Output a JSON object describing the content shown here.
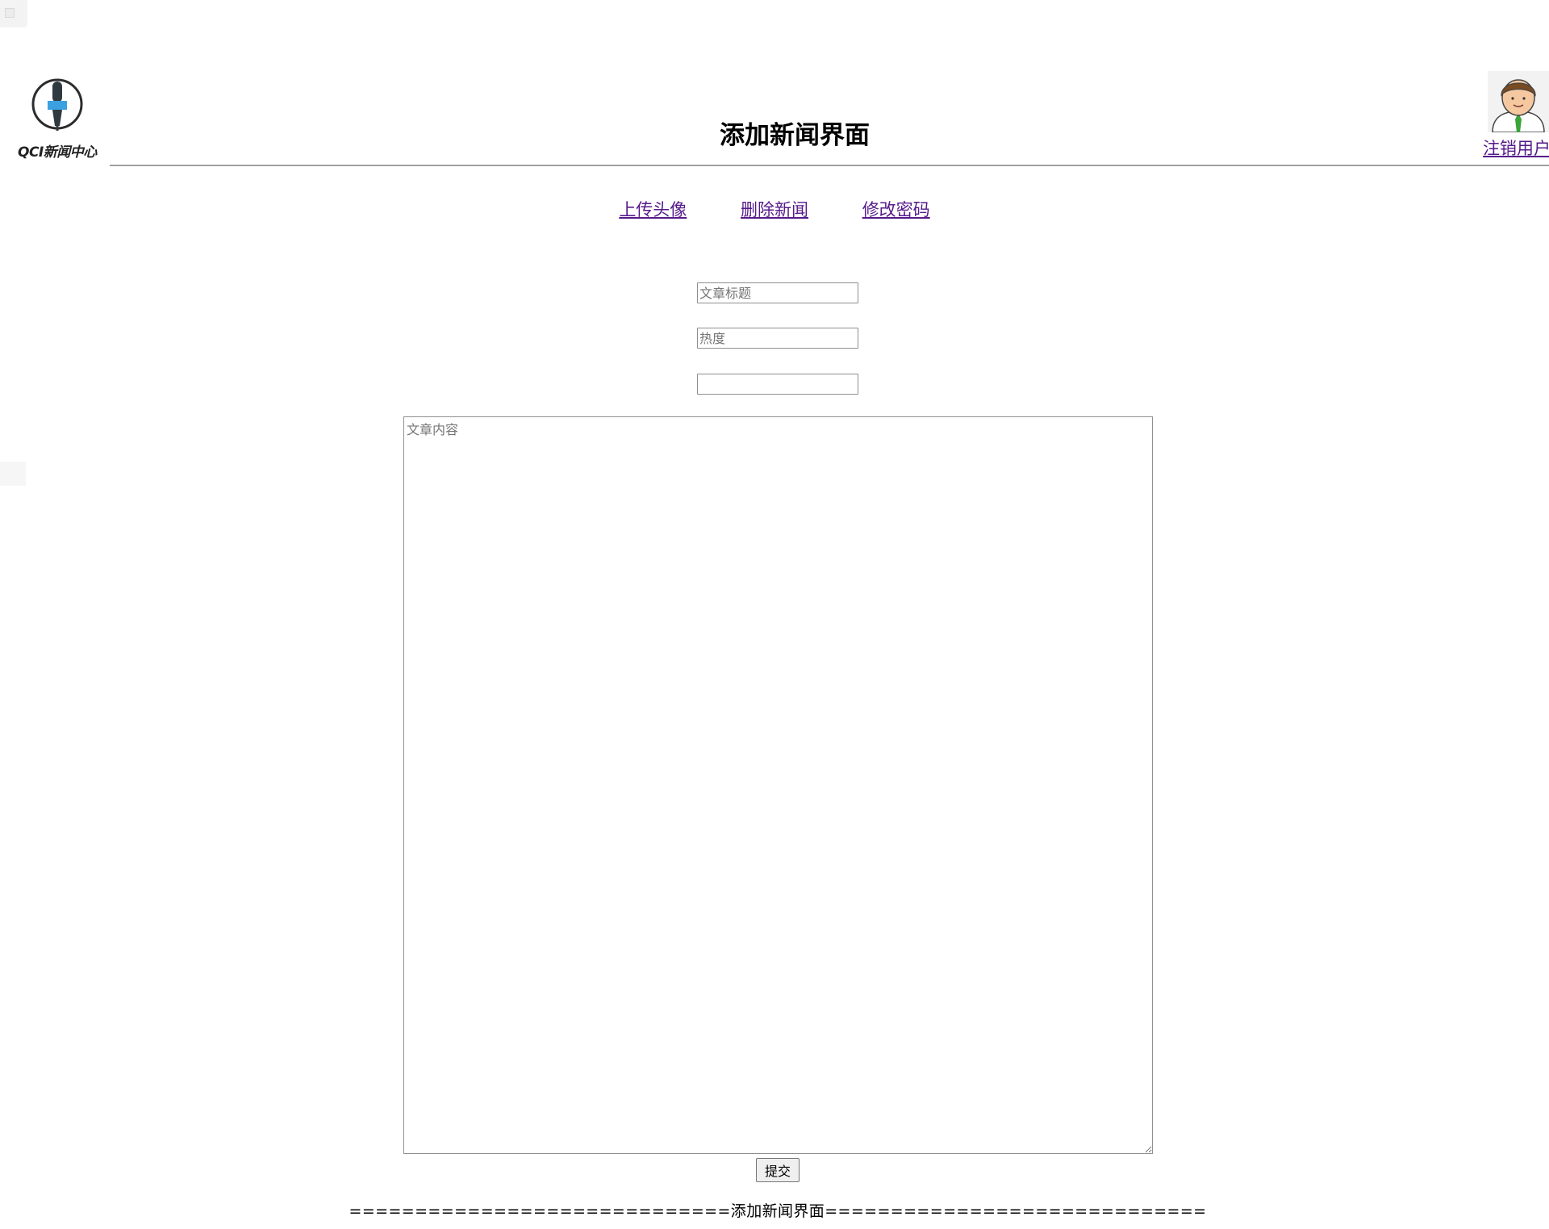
{
  "header": {
    "logo_text": "QCI新闻中心",
    "title": "添加新闻界面",
    "logout_label": "注销用户"
  },
  "nav": {
    "items": [
      {
        "label": "上传头像"
      },
      {
        "label": "删除新闻"
      },
      {
        "label": "修改密码"
      }
    ]
  },
  "form": {
    "title_placeholder": "文章标题",
    "title_value": "",
    "heat_placeholder": "热度",
    "heat_value": "",
    "extra_value": "",
    "content_placeholder": "文章内容",
    "content_value": "",
    "submit_label": "提交"
  },
  "footer": {
    "text": "=============================添加新闻界面============================="
  },
  "colors": {
    "link_visited": "#551a8b",
    "rule": "#a0a0a0",
    "logo_accent": "#3aa0e0"
  }
}
